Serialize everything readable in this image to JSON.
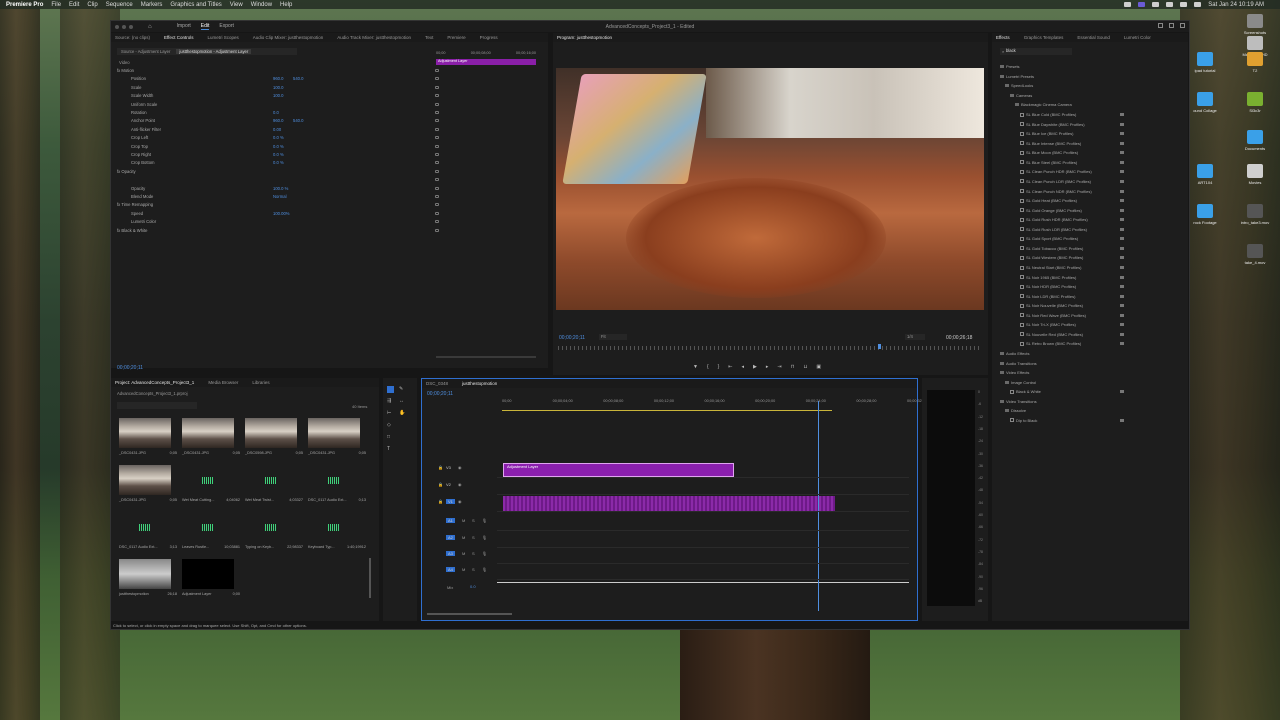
{
  "menubar": {
    "app": "Premiere Pro",
    "items": [
      "File",
      "Edit",
      "Clip",
      "Sequence",
      "Markers",
      "Graphics and Titles",
      "View",
      "Window",
      "Help"
    ],
    "clock": "Sat Jan 24 10:19 AM"
  },
  "window": {
    "title": "AdvancedConcepts_Project3_1 - Edited",
    "workspace_tabs": [
      "Import",
      "Edit",
      "Export"
    ],
    "active_tab": "Edit"
  },
  "source_panel": {
    "tabs": [
      "Source: (no clips)",
      "Effect Controls",
      "Lumetri Scopes",
      "Audio Clip Mixer: justthestopmotion",
      "Audio Track Mixer: justthestopmotion",
      "Text",
      "Premiere",
      "Progress"
    ],
    "source_label": "Source - Adjustment Layer",
    "clip_label": "justthestopmotion - Adjustment Layer",
    "mini_timecodes": [
      "00;00",
      "00;00;08;00",
      "00;00;16;00"
    ],
    "clip_name": "Adjustment Layer",
    "section_video": "Video",
    "rows": [
      {
        "label": "fx  Motion",
        "v1": "",
        "v2": ""
      },
      {
        "label": "Position",
        "v1": "960.0",
        "v2": "540.0"
      },
      {
        "label": "Scale",
        "v1": "100.0",
        "v2": ""
      },
      {
        "label": "Scale Width",
        "v1": "100.0",
        "v2": ""
      },
      {
        "label": "Uniform Scale",
        "v1": "",
        "v2": ""
      },
      {
        "label": "Rotation",
        "v1": "0.0",
        "v2": ""
      },
      {
        "label": "Anchor Point",
        "v1": "960.0",
        "v2": "540.0"
      },
      {
        "label": "Anti-flicker Filter",
        "v1": "0.00",
        "v2": ""
      },
      {
        "label": "Crop Left",
        "v1": "0.0 %",
        "v2": ""
      },
      {
        "label": "Crop Top",
        "v1": "0.0 %",
        "v2": ""
      },
      {
        "label": "Crop Right",
        "v1": "0.0 %",
        "v2": ""
      },
      {
        "label": "Crop Bottom",
        "v1": "0.0 %",
        "v2": ""
      },
      {
        "label": "fx  Opacity",
        "v1": "",
        "v2": ""
      },
      {
        "label": "",
        "v1": "",
        "v2": ""
      },
      {
        "label": "Opacity",
        "v1": "100.0 %",
        "v2": ""
      },
      {
        "label": "Blend Mode",
        "v1": "Normal",
        "v2": ""
      },
      {
        "label": "fx  Time Remapping",
        "v1": "",
        "v2": ""
      },
      {
        "label": "Speed",
        "v1": "100.00%",
        "v2": ""
      },
      {
        "label": "Lumetri Color",
        "v1": "",
        "v2": ""
      },
      {
        "label": "fx  Black & White",
        "v1": "",
        "v2": ""
      }
    ],
    "timecode": "00;00;20;11"
  },
  "program": {
    "tab": "Program: justthestopmotion",
    "timecode": "00;00;20;11",
    "fit": "Fit",
    "quality": "1/4",
    "duration": "00;00;26;18"
  },
  "project": {
    "tabs": [
      "Project: AdvancedConcepts_Project3_1",
      "Media Browser",
      "Libraries"
    ],
    "file": "AdvancedConcepts_Project3_1.prproj",
    "items_count": "40 Items",
    "items": [
      {
        "name": "_DSC0431.JPG",
        "dur": "0;05",
        "kind": "photo"
      },
      {
        "name": "_DSC0431.JPG",
        "dur": "0;05",
        "kind": "photo"
      },
      {
        "name": "_DSC0598.JPG",
        "dur": "0;05",
        "kind": "photo"
      },
      {
        "name": "_DSC0431.JPG",
        "dur": "0;05",
        "kind": "photo"
      },
      {
        "name": "_DSC0431.JPG",
        "dur": "0;05",
        "kind": "photo"
      },
      {
        "name": "Wet Meat Cutting...",
        "dur": "4;04062",
        "kind": "audio"
      },
      {
        "name": "Wet Meat Twist...",
        "dur": "4;03327",
        "kind": "audio"
      },
      {
        "name": "DSC_0117 Audio Ext...",
        "dur": "0;13",
        "kind": "audio"
      },
      {
        "name": "DSC_0117 Audio Ext...",
        "dur": "3;13",
        "kind": "audio"
      },
      {
        "name": "Leaves Rustle...",
        "dur": "10;03881",
        "kind": "audio"
      },
      {
        "name": "Typing on Keyb...",
        "dur": "22;98337",
        "kind": "audio"
      },
      {
        "name": "Keyboard Typ...",
        "dur": "1:40;19912",
        "kind": "audio"
      },
      {
        "name": "justthestopmotion",
        "dur": "26;18",
        "kind": "seq"
      },
      {
        "name": "Adjustment Layer",
        "dur": "0;00",
        "kind": "black"
      }
    ]
  },
  "timeline": {
    "tabs": [
      "DSC_0348",
      "justthestopmotion"
    ],
    "timecode": "00;00;20;11",
    "ruler": [
      "00;00",
      "00;00;04;00",
      "00;00;08;00",
      "00;00;12;00",
      "00;00;16;00",
      "00;00;20;00",
      "00;00;24;00",
      "00;00;28;00",
      "00;00;32"
    ],
    "video_tracks": [
      "V3",
      "V2",
      "V1"
    ],
    "audio_tracks": [
      "A1",
      "A2",
      "A3",
      "A4"
    ],
    "mix_label": "Mix",
    "mix_value": "0.0",
    "adjustment_clip": "Adjustment Layer",
    "playhead_fraction": 0.77
  },
  "meter_scale": [
    "0",
    "-6",
    "-12",
    "-18",
    "-24",
    "-30",
    "-36",
    "-42",
    "-48",
    "-54",
    "-60",
    "-66",
    "-72",
    "-78",
    "-84",
    "-90",
    "-96",
    "dB"
  ],
  "effects": {
    "tabs": [
      "Effects",
      "Graphics Templates",
      "Essential Sound",
      "Lumetri Color"
    ],
    "search": "black",
    "rows": [
      {
        "t": "Presets",
        "d": 0,
        "k": "folder"
      },
      {
        "t": "Lumetri Presets",
        "d": 0,
        "k": "folder"
      },
      {
        "t": "SpeedLooks",
        "d": 1,
        "k": "folder"
      },
      {
        "t": "Cameras",
        "d": 2,
        "k": "folder"
      },
      {
        "t": "Blackmagic Cinema Camera",
        "d": 3,
        "k": "folder"
      },
      {
        "t": "SL Blue Cold (BMC Profiles)",
        "d": 4,
        "k": "preset"
      },
      {
        "t": "SL Blue Daywhite (BMC Profiles)",
        "d": 4,
        "k": "preset"
      },
      {
        "t": "SL Blue Ice (BMC Profiles)",
        "d": 4,
        "k": "preset"
      },
      {
        "t": "SL Blue Intense (BMC Profiles)",
        "d": 4,
        "k": "preset"
      },
      {
        "t": "SL Blue Moon (BMC Profiles)",
        "d": 4,
        "k": "preset"
      },
      {
        "t": "SL Blue Steel (BMC Profiles)",
        "d": 4,
        "k": "preset"
      },
      {
        "t": "SL Clean Punch HDR (BMC Profiles)",
        "d": 4,
        "k": "preset"
      },
      {
        "t": "SL Clean Punch LDR (BMC Profiles)",
        "d": 4,
        "k": "preset"
      },
      {
        "t": "SL Clean Punch NDR (BMC Profiles)",
        "d": 4,
        "k": "preset"
      },
      {
        "t": "SL Gold Heat (BMC Profiles)",
        "d": 4,
        "k": "preset"
      },
      {
        "t": "SL Gold Orange (BMC Profiles)",
        "d": 4,
        "k": "preset"
      },
      {
        "t": "SL Gold Rush HDR (BMC Profiles)",
        "d": 4,
        "k": "preset"
      },
      {
        "t": "SL Gold Rush LDR (BMC Profiles)",
        "d": 4,
        "k": "preset"
      },
      {
        "t": "SL Gold Sport (BMC Profiles)",
        "d": 4,
        "k": "preset"
      },
      {
        "t": "SL Gold Tobacco (BMC Profiles)",
        "d": 4,
        "k": "preset"
      },
      {
        "t": "SL Gold Western (BMC Profiles)",
        "d": 4,
        "k": "preset"
      },
      {
        "t": "SL Neutral Start (BMC Profiles)",
        "d": 4,
        "k": "preset"
      },
      {
        "t": "SL Noir 1965 (BMC Profiles)",
        "d": 4,
        "k": "preset"
      },
      {
        "t": "SL Noir HDR (BMC Profiles)",
        "d": 4,
        "k": "preset"
      },
      {
        "t": "SL Noir LDR (BMC Profiles)",
        "d": 4,
        "k": "preset"
      },
      {
        "t": "SL Noir Nouvelle (BMC Profiles)",
        "d": 4,
        "k": "preset"
      },
      {
        "t": "SL Noir Red Wave (BMC Profiles)",
        "d": 4,
        "k": "preset"
      },
      {
        "t": "SL Noir Tri-X (BMC Profiles)",
        "d": 4,
        "k": "preset"
      },
      {
        "t": "SL Nouvelle Red (BMC Profiles)",
        "d": 4,
        "k": "preset"
      },
      {
        "t": "SL Retro Brown (BMC Profiles)",
        "d": 4,
        "k": "preset"
      },
      {
        "t": "Audio Effects",
        "d": 0,
        "k": "folder"
      },
      {
        "t": "Audio Transitions",
        "d": 0,
        "k": "folder"
      },
      {
        "t": "Video Effects",
        "d": 0,
        "k": "folder"
      },
      {
        "t": "Image Control",
        "d": 1,
        "k": "folder"
      },
      {
        "t": "Black & White",
        "d": 2,
        "k": "preset"
      },
      {
        "t": "Video Transitions",
        "d": 0,
        "k": "folder"
      },
      {
        "t": "Dissolve",
        "d": 1,
        "k": "folder"
      },
      {
        "t": "Dip to Black",
        "d": 2,
        "k": "preset"
      }
    ]
  },
  "status_bar": "Click to select, or click in empty space and drag to marquee select. Use Shift, Opt, and Cmd for other options.",
  "desktop_icons": [
    {
      "label": "Screenshots",
      "color": "#8a8a8a"
    },
    {
      "label": "Macintosh HD",
      "color": "#bdbdbd"
    },
    {
      "label": "ipad tutorial",
      "color": "#3aa0e8"
    },
    {
      "label": "T2",
      "color": "#e0a030"
    },
    {
      "label": "ound Collage",
      "color": "#3aa0e8"
    },
    {
      "label": "Sl3c3r",
      "color": "#7ab030"
    },
    {
      "label": "Documents",
      "color": "#3aa0e8"
    },
    {
      "label": "ART104",
      "color": "#3aa0e8"
    },
    {
      "label": "Movies",
      "color": "#cfcfcf"
    },
    {
      "label": "rock Footage",
      "color": "#3aa0e8"
    },
    {
      "label": "intro_take3.mov",
      "color": "#555"
    },
    {
      "label": "take_4.mov",
      "color": "#555"
    }
  ]
}
